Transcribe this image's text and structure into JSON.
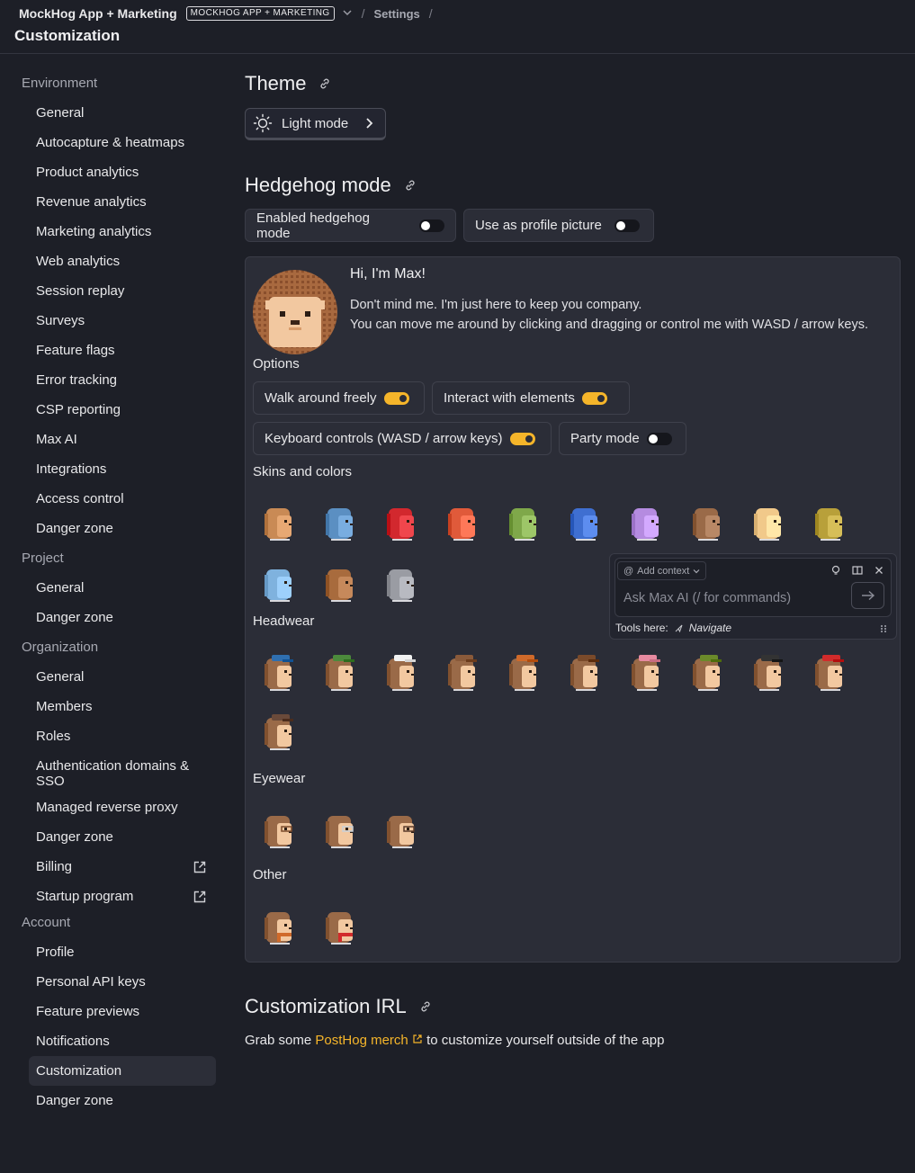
{
  "header": {
    "project_name": "MockHog App + Marketing",
    "project_badge": "MOCKHOG APP + MARKETING",
    "breadcrumb_settings": "Settings",
    "separator": "/",
    "page_title": "Customization"
  },
  "sidebar": {
    "sections": [
      {
        "label": "Environment",
        "items": [
          "General",
          "Autocapture & heatmaps",
          "Product analytics",
          "Revenue analytics",
          "Marketing analytics",
          "Web analytics",
          "Session replay",
          "Surveys",
          "Feature flags",
          "Error tracking",
          "CSP reporting",
          "Max AI",
          "Integrations",
          "Access control",
          "Danger zone"
        ]
      },
      {
        "label": "Project",
        "items": [
          "General",
          "Danger zone"
        ]
      },
      {
        "label": "Organization",
        "items": [
          "General",
          "Members",
          "Roles",
          "Authentication domains & SSO",
          "Managed reverse proxy",
          "Danger zone",
          "Billing",
          "Startup program"
        ]
      },
      {
        "label": "Account",
        "items": [
          "Profile",
          "Personal API keys",
          "Feature previews",
          "Notifications",
          "Customization",
          "Danger zone"
        ]
      }
    ],
    "active_item": "Customization"
  },
  "theme": {
    "heading": "Theme",
    "button_label": "Light mode"
  },
  "hedgehog": {
    "heading": "Hedgehog mode",
    "toggle_enabled_label": "Enabled hedgehog mode",
    "toggle_profile_label": "Use as profile picture",
    "greeting": "Hi, I'm Max!",
    "intro_line1": "Don't mind me. I'm just here to keep you company.",
    "intro_line2": "You can move me around by clicking and dragging or control me with WASD / arrow keys.",
    "options_label": "Options",
    "options": {
      "walk": "Walk around freely",
      "interact": "Interact with elements",
      "keyboard": "Keyboard controls (WASD / arrow keys)",
      "party": "Party mode"
    },
    "skins_label": "Skins and colors",
    "headwear_label": "Headwear",
    "eyewear_label": "Eyewear",
    "other_label": "Other",
    "skin_colors": [
      "#c98a55",
      "#5b8fc2",
      "#d2282e",
      "#e05a3a",
      "#7fa84a",
      "#3f6fd1",
      "#b58be0",
      "#9a6a48",
      "#f1c98a",
      "#b8a03a",
      "#7fb2de",
      "#a86b3d",
      "#9a9ca3"
    ],
    "headwear_colors": [
      "#2f6fb0",
      "#4c8a3c",
      "#f2f2f2",
      "#8a5a3a",
      "#d06a2a",
      "#7a4a2a",
      "#e78aa0",
      "#6b8a2a",
      "#333333",
      "#d22b2b",
      "#6a4a3a"
    ],
    "eyewear_colors": [
      "#7a4a2a",
      "#c8d0d8",
      "#5a3a2a"
    ],
    "other_colors": [
      "#d06a2a",
      "#d22b2b"
    ]
  },
  "max_widget": {
    "add_context": "Add context",
    "placeholder": "Ask Max AI (/ for commands)",
    "tools_label": "Tools here:",
    "tools_value": "Navigate"
  },
  "irl": {
    "heading": "Customization IRL",
    "text_before": "Grab some ",
    "link_text": "PostHog merch",
    "text_after": " to customize yourself outside of the app"
  }
}
